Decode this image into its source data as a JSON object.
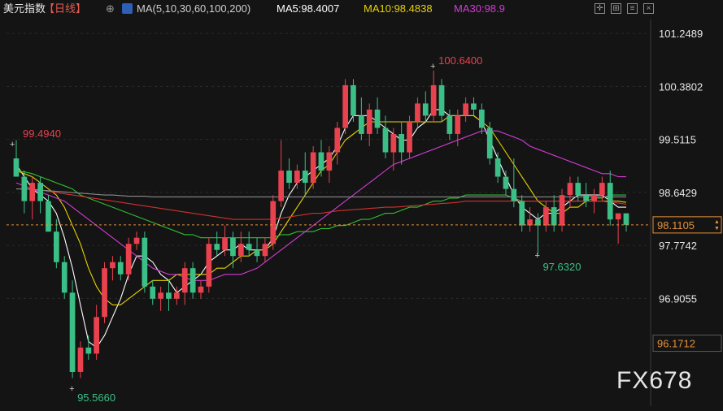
{
  "header": {
    "title": "美元指数",
    "period": "【日线】",
    "ma_params": "MA(5,10,30,60,100,200)",
    "ma5": "MA5:98.4007",
    "ma10": "MA10:98.4838",
    "ma30": "MA30:98.9",
    "colors": {
      "ma5": "#ffffff",
      "ma10": "#e6d200",
      "ma30": "#d23cd2"
    }
  },
  "toolbar_icons": [
    "crosshair-icon",
    "zoom-icon",
    "settings-icon",
    "close-icon"
  ],
  "chart_data": {
    "type": "candlestick",
    "y_ticks": [
      "101.2489",
      "100.3802",
      "99.5115",
      "98.6429",
      "97.7742",
      "96.9055"
    ],
    "ylim": [
      95.3,
      101.45
    ],
    "current_price": "98.1105",
    "low_level": "96.1712",
    "annotations": {
      "high": "100.6400",
      "low": "95.5660",
      "left_high": "99.4940",
      "recent_low": "97.6320"
    },
    "candles": [
      [
        99.2,
        99.5,
        98.9,
        98.9
      ],
      [
        98.9,
        99.0,
        98.3,
        98.5
      ],
      [
        98.5,
        98.9,
        98.2,
        98.8
      ],
      [
        98.8,
        98.9,
        98.3,
        98.5
      ],
      [
        98.5,
        98.6,
        98.0,
        98.0
      ],
      [
        98.0,
        98.2,
        97.4,
        97.5
      ],
      [
        97.5,
        97.6,
        96.9,
        97.0
      ],
      [
        97.0,
        97.2,
        95.6,
        95.7
      ],
      [
        95.7,
        96.2,
        95.6,
        96.1
      ],
      [
        96.1,
        96.3,
        95.9,
        96.0
      ],
      [
        96.0,
        96.8,
        95.9,
        96.6
      ],
      [
        96.6,
        97.5,
        96.5,
        97.4
      ],
      [
        97.4,
        97.6,
        97.2,
        97.5
      ],
      [
        97.5,
        97.6,
        97.2,
        97.3
      ],
      [
        97.3,
        97.9,
        97.2,
        97.8
      ],
      [
        97.8,
        98.0,
        97.7,
        97.9
      ],
      [
        97.9,
        98.0,
        97.0,
        97.1
      ],
      [
        97.1,
        97.2,
        96.8,
        96.9
      ],
      [
        96.9,
        97.1,
        96.7,
        97.0
      ],
      [
        97.0,
        97.2,
        96.7,
        96.9
      ],
      [
        96.9,
        97.1,
        96.8,
        97.0
      ],
      [
        97.0,
        97.5,
        96.8,
        97.4
      ],
      [
        97.4,
        97.5,
        96.9,
        97.0
      ],
      [
        97.0,
        97.2,
        96.9,
        97.1
      ],
      [
        97.1,
        97.9,
        97.0,
        97.8
      ],
      [
        97.8,
        98.0,
        97.6,
        97.7
      ],
      [
        97.7,
        98.1,
        97.6,
        97.9
      ],
      [
        97.9,
        98.0,
        97.4,
        97.6
      ],
      [
        97.6,
        98.0,
        97.5,
        97.8
      ],
      [
        97.8,
        98.0,
        97.6,
        97.7
      ],
      [
        97.7,
        97.9,
        97.5,
        97.6
      ],
      [
        97.6,
        97.9,
        97.5,
        97.8
      ],
      [
        97.8,
        98.6,
        97.7,
        98.5
      ],
      [
        98.5,
        99.5,
        98.4,
        99.0
      ],
      [
        99.0,
        99.2,
        98.7,
        98.8
      ],
      [
        98.8,
        99.1,
        98.7,
        99.0
      ],
      [
        99.0,
        99.3,
        98.6,
        98.8
      ],
      [
        98.8,
        99.4,
        98.7,
        99.3
      ],
      [
        99.3,
        99.5,
        98.9,
        99.0
      ],
      [
        99.0,
        99.4,
        98.8,
        99.3
      ],
      [
        99.3,
        99.8,
        99.1,
        99.7
      ],
      [
        99.7,
        100.5,
        99.6,
        100.4
      ],
      [
        100.4,
        100.5,
        99.8,
        99.9
      ],
      [
        99.9,
        100.2,
        99.5,
        99.6
      ],
      [
        99.6,
        100.1,
        99.4,
        100.0
      ],
      [
        100.0,
        100.2,
        99.6,
        99.7
      ],
      [
        99.7,
        99.9,
        99.2,
        99.3
      ],
      [
        99.3,
        99.7,
        99.0,
        99.6
      ],
      [
        99.6,
        99.8,
        99.1,
        99.3
      ],
      [
        99.3,
        99.9,
        99.2,
        99.8
      ],
      [
        99.8,
        100.2,
        99.7,
        100.1
      ],
      [
        100.1,
        100.3,
        99.8,
        99.9
      ],
      [
        99.9,
        100.64,
        99.8,
        100.4
      ],
      [
        100.4,
        100.5,
        99.8,
        99.9
      ],
      [
        99.9,
        100.0,
        99.5,
        99.6
      ],
      [
        99.6,
        100.0,
        99.4,
        99.9
      ],
      [
        99.9,
        100.2,
        99.8,
        100.1
      ],
      [
        100.1,
        100.2,
        99.9,
        100.0
      ],
      [
        100.0,
        100.1,
        99.6,
        99.7
      ],
      [
        99.7,
        99.8,
        99.1,
        99.2
      ],
      [
        99.2,
        99.3,
        98.8,
        98.9
      ],
      [
        98.9,
        99.0,
        98.6,
        98.7
      ],
      [
        98.7,
        99.2,
        98.4,
        98.5
      ],
      [
        98.5,
        98.6,
        98.0,
        98.1
      ],
      [
        98.1,
        98.4,
        98.0,
        98.2
      ],
      [
        98.2,
        98.3,
        97.63,
        98.1
      ],
      [
        98.1,
        98.5,
        98.0,
        98.4
      ],
      [
        98.4,
        98.6,
        98.0,
        98.1
      ],
      [
        98.1,
        98.7,
        98.0,
        98.6
      ],
      [
        98.6,
        98.9,
        98.4,
        98.8
      ],
      [
        98.8,
        98.9,
        98.5,
        98.6
      ],
      [
        98.6,
        98.8,
        98.4,
        98.5
      ],
      [
        98.5,
        98.7,
        98.3,
        98.6
      ],
      [
        98.6,
        98.9,
        98.5,
        98.8
      ],
      [
        98.8,
        99.0,
        98.1,
        98.2
      ],
      [
        98.2,
        98.3,
        97.8,
        98.3
      ],
      [
        98.3,
        98.3,
        98.0,
        98.11
      ]
    ],
    "ma_series": [
      {
        "name": "MA5",
        "color": "#ffffff",
        "values": [
          99.1,
          98.9,
          98.7,
          98.6,
          98.5,
          98.3,
          97.9,
          97.4,
          96.8,
          96.2,
          96.1,
          96.3,
          96.6,
          96.9,
          97.3,
          97.6,
          97.6,
          97.5,
          97.3,
          97.2,
          97.0,
          97.1,
          97.2,
          97.3,
          97.5,
          97.6,
          97.7,
          97.7,
          97.8,
          97.7,
          97.7,
          97.7,
          97.9,
          98.3,
          98.6,
          98.8,
          98.9,
          99.0,
          99.1,
          99.2,
          99.4,
          99.7,
          99.9,
          99.9,
          99.9,
          99.8,
          99.7,
          99.6,
          99.5,
          99.5,
          99.7,
          99.8,
          100.0,
          100.0,
          99.9,
          99.9,
          99.9,
          99.9,
          99.8,
          99.5,
          99.2,
          98.9,
          98.6,
          98.4,
          98.3,
          98.2,
          98.3,
          98.3,
          98.4,
          98.5,
          98.6,
          98.6,
          98.6,
          98.6,
          98.5,
          98.4,
          98.4
        ]
      },
      {
        "name": "MA10",
        "color": "#e6d200",
        "values": [
          99.0,
          98.95,
          98.9,
          98.8,
          98.7,
          98.6,
          98.4,
          98.1,
          97.8,
          97.4,
          97.1,
          96.9,
          96.8,
          96.8,
          96.9,
          97.0,
          97.1,
          97.2,
          97.2,
          97.2,
          97.3,
          97.3,
          97.3,
          97.3,
          97.3,
          97.4,
          97.4,
          97.5,
          97.6,
          97.6,
          97.7,
          97.7,
          97.8,
          98.0,
          98.2,
          98.4,
          98.6,
          98.8,
          99.0,
          99.1,
          99.3,
          99.5,
          99.6,
          99.7,
          99.8,
          99.8,
          99.8,
          99.8,
          99.8,
          99.8,
          99.8,
          99.8,
          99.8,
          99.8,
          99.9,
          99.9,
          99.9,
          99.9,
          99.8,
          99.7,
          99.5,
          99.3,
          99.1,
          98.9,
          98.7,
          98.5,
          98.4,
          98.3,
          98.3,
          98.4,
          98.4,
          98.5,
          98.5,
          98.5,
          98.5,
          98.5,
          98.48
        ]
      },
      {
        "name": "MA30",
        "color": "#d23cd2",
        "values": [
          98.8,
          98.75,
          98.7,
          98.65,
          98.6,
          98.55,
          98.5,
          98.4,
          98.3,
          98.2,
          98.1,
          98.0,
          97.9,
          97.8,
          97.7,
          97.6,
          97.5,
          97.4,
          97.35,
          97.3,
          97.3,
          97.25,
          97.2,
          97.2,
          97.2,
          97.25,
          97.3,
          97.3,
          97.3,
          97.35,
          97.4,
          97.5,
          97.6,
          97.7,
          97.8,
          97.9,
          98.0,
          98.1,
          98.2,
          98.3,
          98.4,
          98.5,
          98.6,
          98.7,
          98.8,
          98.9,
          99.0,
          99.1,
          99.15,
          99.2,
          99.25,
          99.3,
          99.35,
          99.4,
          99.45,
          99.5,
          99.55,
          99.6,
          99.65,
          99.65,
          99.65,
          99.6,
          99.55,
          99.5,
          99.4,
          99.35,
          99.3,
          99.25,
          99.2,
          99.15,
          99.1,
          99.05,
          99.0,
          98.95,
          98.95,
          98.9,
          98.9
        ]
      },
      {
        "name": "MA60",
        "color": "#2fbf2f",
        "values": [
          99.0,
          98.98,
          98.95,
          98.9,
          98.85,
          98.8,
          98.75,
          98.7,
          98.6,
          98.55,
          98.5,
          98.45,
          98.4,
          98.35,
          98.3,
          98.25,
          98.2,
          98.15,
          98.1,
          98.05,
          98.0,
          97.95,
          97.95,
          97.9,
          97.9,
          97.9,
          97.9,
          97.9,
          97.9,
          97.9,
          97.9,
          97.9,
          97.9,
          97.95,
          97.95,
          98.0,
          98.0,
          98.0,
          98.05,
          98.05,
          98.1,
          98.1,
          98.15,
          98.2,
          98.2,
          98.25,
          98.3,
          98.3,
          98.35,
          98.4,
          98.4,
          98.45,
          98.5,
          98.5,
          98.55,
          98.55,
          98.6,
          98.6,
          98.6,
          98.6,
          98.6,
          98.6,
          98.55,
          98.5,
          98.5,
          98.5,
          98.5,
          98.5,
          98.5,
          98.5,
          98.5,
          98.5,
          98.55,
          98.55,
          98.6,
          98.6,
          98.6
        ]
      },
      {
        "name": "MA100",
        "color": "#d03030",
        "values": [
          98.7,
          98.7,
          98.7,
          98.68,
          98.66,
          98.64,
          98.62,
          98.6,
          98.58,
          98.56,
          98.54,
          98.52,
          98.5,
          98.48,
          98.46,
          98.44,
          98.42,
          98.4,
          98.38,
          98.36,
          98.34,
          98.32,
          98.3,
          98.28,
          98.26,
          98.24,
          98.22,
          98.2,
          98.2,
          98.2,
          98.2,
          98.2,
          98.2,
          98.22,
          98.24,
          98.26,
          98.28,
          98.3,
          98.3,
          98.32,
          98.34,
          98.35,
          98.36,
          98.37,
          98.38,
          98.39,
          98.4,
          98.4,
          98.41,
          98.42,
          98.43,
          98.44,
          98.45,
          98.46,
          98.47,
          98.48,
          98.5,
          98.5,
          98.5,
          98.5,
          98.5,
          98.5,
          98.5,
          98.5,
          98.5,
          98.5,
          98.5,
          98.5,
          98.5,
          98.5,
          98.5,
          98.5,
          98.5,
          98.5,
          98.48,
          98.47,
          98.45
        ]
      },
      {
        "name": "MA200",
        "color": "#8a8a8a",
        "values": [
          98.7,
          98.7,
          98.69,
          98.68,
          98.67,
          98.66,
          98.65,
          98.64,
          98.63,
          98.62,
          98.61,
          98.6,
          98.6,
          98.59,
          98.58,
          98.58,
          98.58,
          98.57,
          98.57,
          98.57,
          98.57,
          98.57,
          98.57,
          98.57,
          98.57,
          98.57,
          98.57,
          98.57,
          98.57,
          98.57,
          98.57,
          98.57,
          98.57,
          98.57,
          98.57,
          98.57,
          98.57,
          98.57,
          98.57,
          98.57,
          98.57,
          98.57,
          98.57,
          98.57,
          98.57,
          98.57,
          98.57,
          98.57,
          98.57,
          98.57,
          98.57,
          98.57,
          98.57,
          98.57,
          98.57,
          98.57,
          98.57,
          98.57,
          98.57,
          98.57,
          98.57,
          98.57,
          98.57,
          98.57,
          98.57,
          98.57,
          98.57,
          98.57,
          98.57,
          98.57,
          98.57,
          98.57,
          98.57,
          98.57,
          98.57,
          98.57,
          98.57
        ]
      }
    ],
    "colors": {
      "up": "#e8424f",
      "down": "#3cbf86",
      "price_line": "#e69138",
      "label_high": "#e8424f",
      "label_low": "#3cbf86"
    }
  },
  "watermark": "FX678"
}
